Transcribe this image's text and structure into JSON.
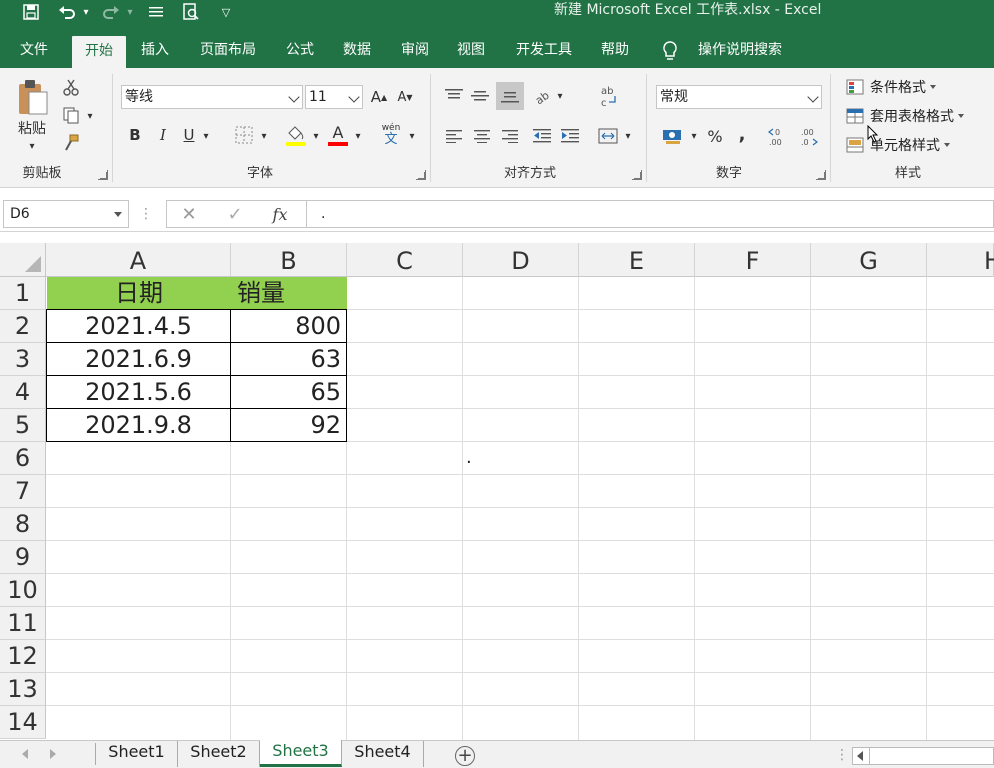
{
  "window": {
    "title": "新建 Microsoft Excel 工作表.xlsx  -  Excel"
  },
  "qat": {
    "save_icon": "save-icon",
    "undo_icon": "undo-icon",
    "redo_icon": "redo-icon",
    "customize_icon": "customize-qat-icon",
    "preview_icon": "print-preview-icon"
  },
  "tabs": [
    "文件",
    "开始",
    "插入",
    "页面布局",
    "公式",
    "数据",
    "审阅",
    "视图",
    "开发工具",
    "帮助"
  ],
  "active_tab": "开始",
  "tell_me": "操作说明搜索",
  "ribbon": {
    "clipboard": {
      "paste": "粘贴",
      "label": "剪贴板"
    },
    "font": {
      "name": "等线",
      "size": "11",
      "label": "字体",
      "bold": "B",
      "italic": "I",
      "underline": "U",
      "font_color_letter": "A",
      "phonetic": "wén"
    },
    "alignment": {
      "label": "对齐方式"
    },
    "number": {
      "format": "常规",
      "label": "数字",
      "percent": "%",
      "comma": ","
    },
    "styles": {
      "conditional": "条件格式",
      "table": "套用表格格式",
      "cell": "单元格样式",
      "label": "样式"
    }
  },
  "formula_bar": {
    "name_box": "D6",
    "cancel_symbol": "✕",
    "enter_symbol": "✓",
    "fx": "fx",
    "content": "."
  },
  "columns": [
    "A",
    "B",
    "C",
    "D",
    "E",
    "F",
    "G",
    "H"
  ],
  "rows": [
    "1",
    "2",
    "3",
    "4",
    "5",
    "6",
    "7",
    "8",
    "9",
    "10",
    "11",
    "12",
    "13",
    "14"
  ],
  "table": {
    "header": [
      "日期",
      "销量"
    ],
    "rows": [
      [
        "2021.4.5",
        "800"
      ],
      [
        "2021.6.9",
        "63"
      ],
      [
        "2021.5.6",
        "65"
      ],
      [
        "2021.9.8",
        "92"
      ]
    ]
  },
  "cell_d6": ".",
  "colors": {
    "accent": "#217346",
    "header_fill": "#92d050"
  },
  "sheets": [
    "Sheet1",
    "Sheet2",
    "Sheet3",
    "Sheet4"
  ],
  "active_sheet": "Sheet3",
  "add_sheet": "+"
}
